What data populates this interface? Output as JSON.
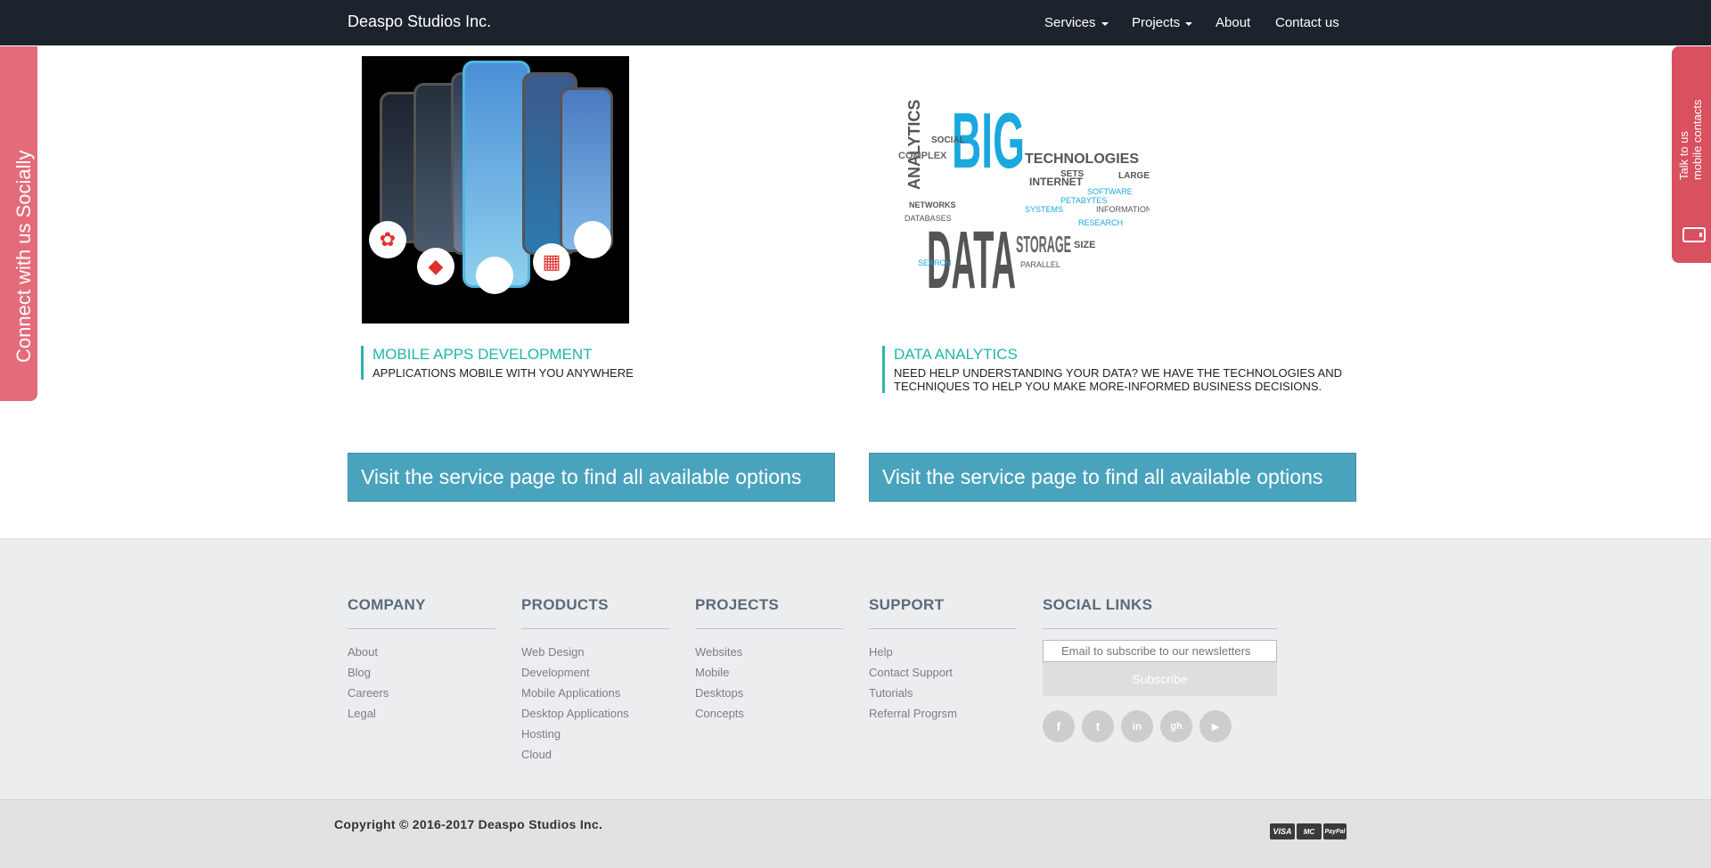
{
  "navbar": {
    "brand": "Deaspo Studios Inc.",
    "items": [
      {
        "label": "Services",
        "dropdown": true
      },
      {
        "label": "Projects",
        "dropdown": true
      },
      {
        "label": "About",
        "dropdown": false
      },
      {
        "label": "Contact us",
        "dropdown": false
      }
    ]
  },
  "side_tabs": {
    "social_label": "Connect with us Socially",
    "contact_line1": "Talk to us",
    "contact_line2": "mobile contacts",
    "contact_icon": "mobile-phone-icon"
  },
  "services": [
    {
      "title": "MOBILE APPS DEVELOPMENT",
      "description": "APPLICATIONS MOBILE WITH YOU ANYWHERE",
      "button": "Visit the service page to find all available options"
    },
    {
      "title": "DATA ANALYTICS",
      "description": "NEED HELP UNDERSTANDING YOUR DATA? WE HAVE THE TECHNOLOGIES AND TECHNIQUES TO HELP YOU MAKE MORE-INFORMED BUSINESS DECISIONS.",
      "button": "Visit the service page to find all available options"
    }
  ],
  "bigdata_image": {
    "big": "BIG",
    "data": "DATA",
    "words": [
      "ANALYTICS",
      "TECHNOLOGIES",
      "STORAGE",
      "INTERNET",
      "COMPLEX",
      "INFORMATION",
      "DATABASES",
      "SOCIAL",
      "SOFTWARE",
      "SYSTEMS",
      "PETABYTES",
      "NETWORKS",
      "RESEARCH",
      "SEARCH",
      "PARALLEL",
      "SIZE",
      "SETS",
      "LARGE"
    ]
  },
  "footer": {
    "columns": [
      {
        "heading": "COMPANY",
        "links": [
          "About",
          "Blog",
          "Careers",
          "Legal"
        ]
      },
      {
        "heading": "PRODUCTS",
        "links": [
          "Web Design",
          "Development",
          "Mobile Applications",
          "Desktop Applications",
          "Hosting",
          "Cloud"
        ]
      },
      {
        "heading": "PROJECTS",
        "links": [
          "Websites",
          "Mobile",
          "Desktops",
          "Concepts"
        ]
      },
      {
        "heading": "SUPPORT",
        "links": [
          "Help",
          "Contact Support",
          "Tutorials",
          "Referral Progrsm"
        ]
      },
      {
        "heading": "SOCIAL LINKS",
        "links": []
      }
    ],
    "newsletter_placeholder": "Email to subscribe to our newsletters",
    "subscribe_label": "Subscribe",
    "social_icons": [
      {
        "icon": "facebook-icon",
        "glyph": "f"
      },
      {
        "icon": "twitter-icon",
        "glyph": "t"
      },
      {
        "icon": "linkedin-icon",
        "glyph": "in"
      },
      {
        "icon": "github-icon",
        "glyph": "gh"
      },
      {
        "icon": "youtube-icon",
        "glyph": "▶"
      }
    ],
    "copyright": "Copyright © 2016-2017 Deaspo Studios Inc.",
    "payment_icons": [
      {
        "icon": "visa-icon",
        "label": "VISA"
      },
      {
        "icon": "mastercard-icon",
        "label": "MC"
      },
      {
        "icon": "paypal-icon",
        "label": "PayPal"
      }
    ]
  },
  "colors": {
    "navbar_bg": "#1c232c",
    "accent_teal": "#1fb6a6",
    "button_blue": "#4aa3bd",
    "side_tab_pink": "#e46b79",
    "contact_tab_red": "#d9505f"
  }
}
